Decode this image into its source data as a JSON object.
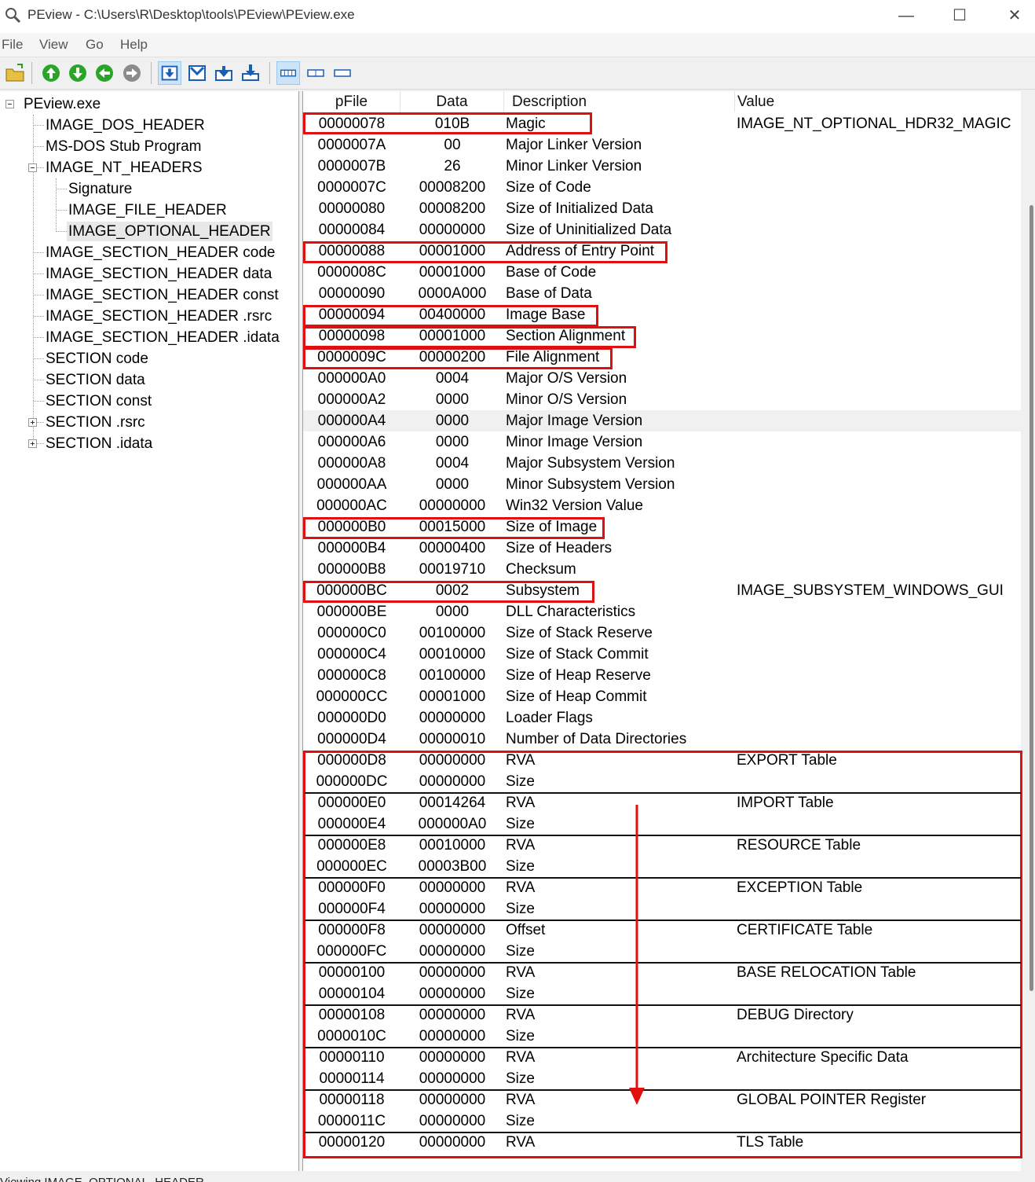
{
  "window": {
    "title": "PEview - C:\\Users\\R\\Desktop\\tools\\PEview\\PEview.exe",
    "minimize_glyph": "—",
    "maximize_glyph": "☐",
    "close_glyph": "✕"
  },
  "menu": [
    "File",
    "View",
    "Go",
    "Help"
  ],
  "toolbar": {
    "buttons": [
      "open-icon",
      "up-icon",
      "down-icon",
      "back-icon",
      "forward-icon",
      "view-byte-icon",
      "view-word-icon",
      "view-dword-icon",
      "view-qword-icon",
      "details-icon",
      "list-icon",
      "small-icon"
    ]
  },
  "tree": [
    {
      "label": "PEview.exe"
    },
    {
      "label": "IMAGE_DOS_HEADER"
    },
    {
      "label": "MS-DOS Stub Program"
    },
    {
      "label": "IMAGE_NT_HEADERS"
    },
    {
      "label": "Signature"
    },
    {
      "label": "IMAGE_FILE_HEADER"
    },
    {
      "label": "IMAGE_OPTIONAL_HEADER"
    },
    {
      "label": "IMAGE_SECTION_HEADER code"
    },
    {
      "label": "IMAGE_SECTION_HEADER data"
    },
    {
      "label": "IMAGE_SECTION_HEADER const"
    },
    {
      "label": "IMAGE_SECTION_HEADER .rsrc"
    },
    {
      "label": "IMAGE_SECTION_HEADER .idata"
    },
    {
      "label": "SECTION code"
    },
    {
      "label": "SECTION data"
    },
    {
      "label": "SECTION const"
    },
    {
      "label": "SECTION .rsrc"
    },
    {
      "label": "SECTION .idata"
    }
  ],
  "columns": {
    "pfile": "pFile",
    "data": "Data",
    "description": "Description",
    "value": "Value"
  },
  "rows": [
    {
      "pfile": "00000078",
      "data": "010B",
      "desc": "Magic",
      "value": "IMAGE_NT_OPTIONAL_HDR32_MAGIC"
    },
    {
      "pfile": "0000007A",
      "data": "00",
      "desc": "Major Linker Version",
      "value": ""
    },
    {
      "pfile": "0000007B",
      "data": "26",
      "desc": "Minor Linker Version",
      "value": ""
    },
    {
      "pfile": "0000007C",
      "data": "00008200",
      "desc": "Size of Code",
      "value": ""
    },
    {
      "pfile": "00000080",
      "data": "00008200",
      "desc": "Size of Initialized Data",
      "value": ""
    },
    {
      "pfile": "00000084",
      "data": "00000000",
      "desc": "Size of Uninitialized Data",
      "value": ""
    },
    {
      "pfile": "00000088",
      "data": "00001000",
      "desc": "Address of Entry Point",
      "value": ""
    },
    {
      "pfile": "0000008C",
      "data": "00001000",
      "desc": "Base of Code",
      "value": ""
    },
    {
      "pfile": "00000090",
      "data": "0000A000",
      "desc": "Base of Data",
      "value": ""
    },
    {
      "pfile": "00000094",
      "data": "00400000",
      "desc": "Image Base",
      "value": ""
    },
    {
      "pfile": "00000098",
      "data": "00001000",
      "desc": "Section Alignment",
      "value": ""
    },
    {
      "pfile": "0000009C",
      "data": "00000200",
      "desc": "File Alignment",
      "value": ""
    },
    {
      "pfile": "000000A0",
      "data": "0004",
      "desc": "Major O/S Version",
      "value": ""
    },
    {
      "pfile": "000000A2",
      "data": "0000",
      "desc": "Minor O/S Version",
      "value": ""
    },
    {
      "pfile": "000000A4",
      "data": "0000",
      "desc": "Major Image Version",
      "value": ""
    },
    {
      "pfile": "000000A6",
      "data": "0000",
      "desc": "Minor Image Version",
      "value": ""
    },
    {
      "pfile": "000000A8",
      "data": "0004",
      "desc": "Major Subsystem Version",
      "value": ""
    },
    {
      "pfile": "000000AA",
      "data": "0000",
      "desc": "Minor Subsystem Version",
      "value": ""
    },
    {
      "pfile": "000000AC",
      "data": "00000000",
      "desc": "Win32 Version Value",
      "value": ""
    },
    {
      "pfile": "000000B0",
      "data": "00015000",
      "desc": "Size of Image",
      "value": ""
    },
    {
      "pfile": "000000B4",
      "data": "00000400",
      "desc": "Size of Headers",
      "value": ""
    },
    {
      "pfile": "000000B8",
      "data": "00019710",
      "desc": "Checksum",
      "value": ""
    },
    {
      "pfile": "000000BC",
      "data": "0002",
      "desc": "Subsystem",
      "value": "IMAGE_SUBSYSTEM_WINDOWS_GUI"
    },
    {
      "pfile": "000000BE",
      "data": "0000",
      "desc": "DLL Characteristics",
      "value": ""
    },
    {
      "pfile": "000000C0",
      "data": "00100000",
      "desc": "Size of Stack Reserve",
      "value": ""
    },
    {
      "pfile": "000000C4",
      "data": "00010000",
      "desc": "Size of Stack Commit",
      "value": ""
    },
    {
      "pfile": "000000C8",
      "data": "00100000",
      "desc": "Size of Heap Reserve",
      "value": ""
    },
    {
      "pfile": "000000CC",
      "data": "00001000",
      "desc": "Size of Heap Commit",
      "value": ""
    },
    {
      "pfile": "000000D0",
      "data": "00000000",
      "desc": "Loader Flags",
      "value": ""
    },
    {
      "pfile": "000000D4",
      "data": "00000010",
      "desc": "Number of Data Directories",
      "value": ""
    },
    {
      "pfile": "000000D8",
      "data": "00000000",
      "desc": "RVA",
      "value": "EXPORT Table"
    },
    {
      "pfile": "000000DC",
      "data": "00000000",
      "desc": "Size",
      "value": ""
    },
    {
      "pfile": "000000E0",
      "data": "00014264",
      "desc": "RVA",
      "value": "IMPORT Table"
    },
    {
      "pfile": "000000E4",
      "data": "000000A0",
      "desc": "Size",
      "value": ""
    },
    {
      "pfile": "000000E8",
      "data": "00010000",
      "desc": "RVA",
      "value": "RESOURCE Table"
    },
    {
      "pfile": "000000EC",
      "data": "00003B00",
      "desc": "Size",
      "value": ""
    },
    {
      "pfile": "000000F0",
      "data": "00000000",
      "desc": "RVA",
      "value": "EXCEPTION Table"
    },
    {
      "pfile": "000000F4",
      "data": "00000000",
      "desc": "Size",
      "value": ""
    },
    {
      "pfile": "000000F8",
      "data": "00000000",
      "desc": "Offset",
      "value": "CERTIFICATE Table"
    },
    {
      "pfile": "000000FC",
      "data": "00000000",
      "desc": "Size",
      "value": ""
    },
    {
      "pfile": "00000100",
      "data": "00000000",
      "desc": "RVA",
      "value": "BASE RELOCATION Table"
    },
    {
      "pfile": "00000104",
      "data": "00000000",
      "desc": "Size",
      "value": ""
    },
    {
      "pfile": "00000108",
      "data": "00000000",
      "desc": "RVA",
      "value": "DEBUG Directory"
    },
    {
      "pfile": "0000010C",
      "data": "00000000",
      "desc": "Size",
      "value": ""
    },
    {
      "pfile": "00000110",
      "data": "00000000",
      "desc": "RVA",
      "value": "Architecture Specific Data"
    },
    {
      "pfile": "00000114",
      "data": "00000000",
      "desc": "Size",
      "value": ""
    },
    {
      "pfile": "00000118",
      "data": "00000000",
      "desc": "RVA",
      "value": "GLOBAL POINTER Register"
    },
    {
      "pfile": "0000011C",
      "data": "00000000",
      "desc": "Size",
      "value": ""
    },
    {
      "pfile": "00000120",
      "data": "00000000",
      "desc": "RVA",
      "value": "TLS Table"
    }
  ],
  "status": {
    "text": "Viewing IMAGE_OPTIONAL_HEADER"
  },
  "colors": {
    "annotation": "#e01010",
    "selected_row": "#f0f0f0",
    "toolbar_active": "#cce4f7"
  }
}
